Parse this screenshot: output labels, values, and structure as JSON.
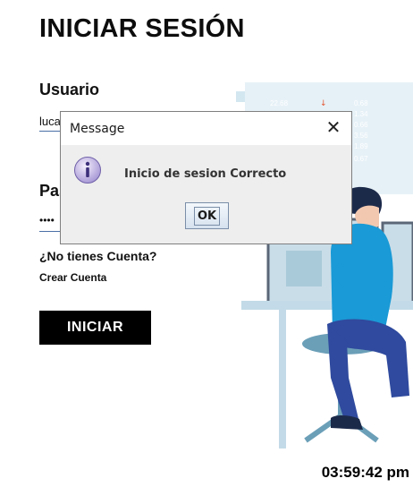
{
  "login": {
    "title": "INICIAR SESIÓN",
    "user_label": "Usuario",
    "user_value": "luca",
    "password_label": "Pas",
    "password_value": "••••",
    "question": "¿No tienes Cuenta?",
    "create_account": "Crear Cuenta",
    "submit_label": "INICIAR"
  },
  "clock": {
    "time": "03:59:42 pm"
  },
  "illustration": {
    "screen_values": [
      "22.68",
      "0.68",
      "1.34",
      "0.66",
      "3.56",
      "1.89",
      "0.67"
    ]
  },
  "dialog": {
    "title": "Message",
    "close_glyph": "✕",
    "message": "Inicio de sesion Correcto",
    "ok_label": "OK",
    "icon": "information-icon"
  },
  "colors": {
    "accent": "#000000",
    "dialog_bg": "#eeeeee",
    "figure_shirt": "#1a9ad6",
    "figure_pants": "#2f4a9e"
  }
}
